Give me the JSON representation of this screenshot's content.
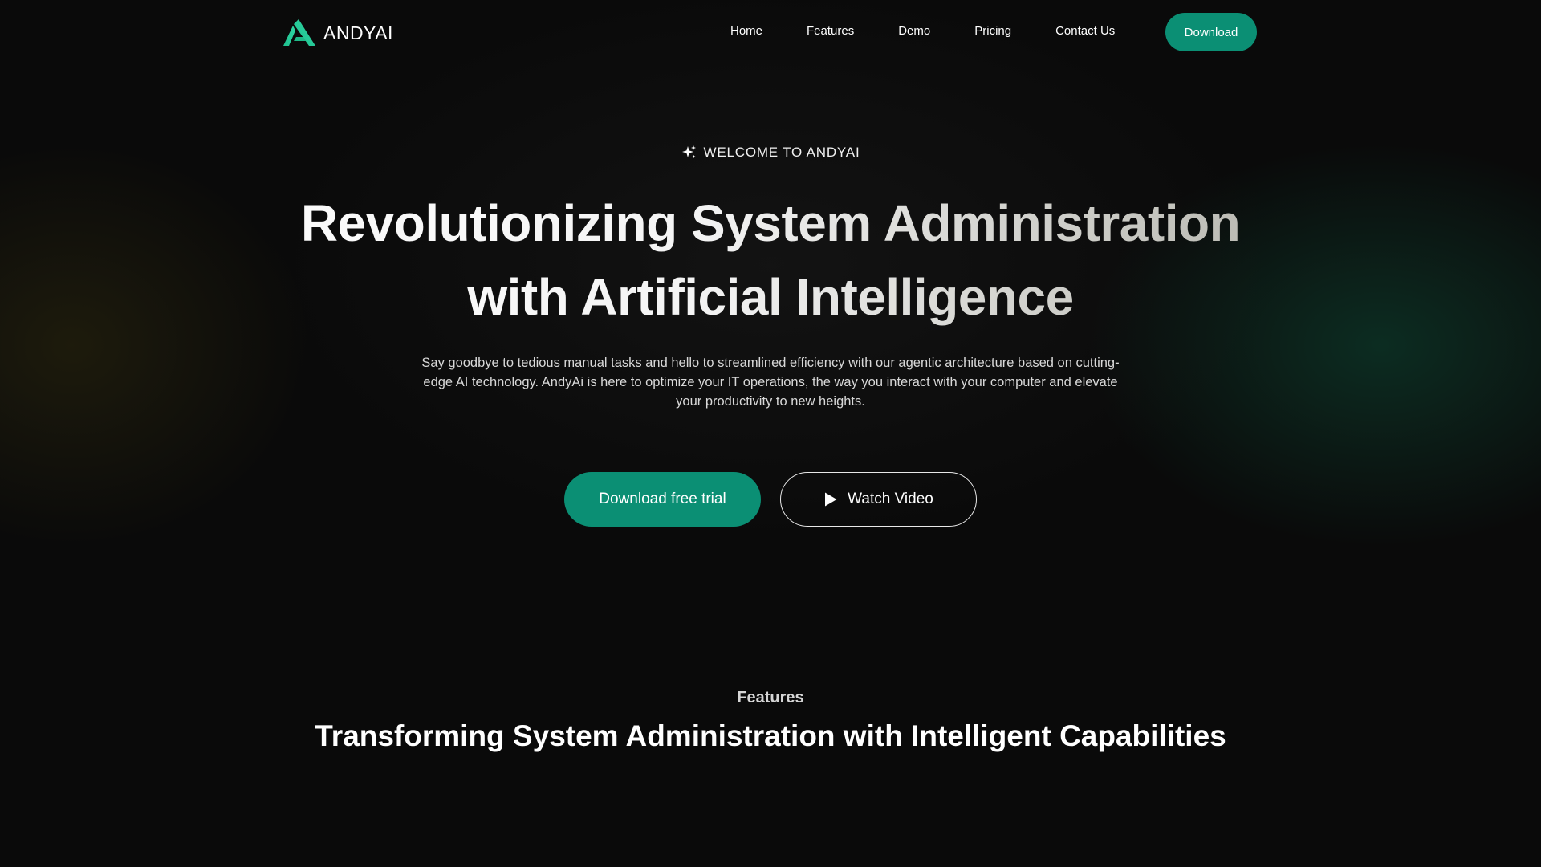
{
  "brand": {
    "name": "ANDYAI",
    "accent_color": "#0b8f74",
    "logo_icon": "andyai-logo-icon"
  },
  "nav": {
    "links": [
      {
        "label": "Home"
      },
      {
        "label": "Features"
      },
      {
        "label": "Demo"
      },
      {
        "label": "Pricing"
      },
      {
        "label": "Contact Us"
      }
    ],
    "download_label": "Download"
  },
  "hero": {
    "eyebrow_icon": "sparkle-icon",
    "eyebrow": "WELCOME TO ANDYAI",
    "title_line1": "Revolutionizing System Administration",
    "title_line2": "with Artificial Intelligence",
    "description": "Say goodbye to tedious manual tasks and hello to streamlined efficiency with our agentic architecture based on cutting-edge AI technology. AndyAi is here to optimize your IT operations, the way you interact with your computer and elevate your productivity to new heights.",
    "primary_cta": "Download free trial",
    "secondary_cta": "Watch Video",
    "secondary_cta_icon": "play-icon"
  },
  "features": {
    "eyebrow": "Features",
    "title": "Transforming System Administration with Intelligent Capabilities"
  }
}
